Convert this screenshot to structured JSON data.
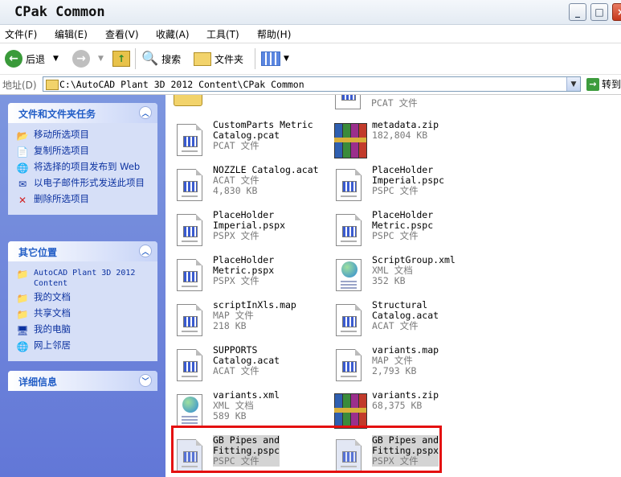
{
  "window": {
    "title": "CPak Common"
  },
  "menu": {
    "items": [
      "文件(F)",
      "编辑(E)",
      "查看(V)",
      "收藏(A)",
      "工具(T)",
      "帮助(H)"
    ]
  },
  "toolbar": {
    "back_label": "后退",
    "search_label": "搜索",
    "folders_label": "文件夹"
  },
  "address": {
    "label": "地址(D)",
    "path": "C:\\AutoCAD Plant 3D 2012 Content\\CPak Common",
    "go_label": "转到"
  },
  "left_pane": {
    "tasks": {
      "title": "文件和文件夹任务",
      "items": [
        "移动所选项目",
        "复制所选项目",
        "将选择的项目发布到 Web",
        "以电子邮件形式发送此项目",
        "删除所选项目"
      ]
    },
    "places": {
      "title": "其它位置",
      "items": [
        "AutoCAD Plant 3D 2012 Content",
        "我的文档",
        "共享文档",
        "我的电脑",
        "网上邻居"
      ]
    },
    "details": {
      "title": "详细信息"
    }
  },
  "files": [
    {
      "line1": "CustomParts Metric",
      "line2": "Catalog.pcat",
      "line3": "PCAT 文件",
      "icon": "doc-icon"
    },
    {
      "line1": "metadata.zip",
      "line2": "182,804 KB",
      "line3": "",
      "icon": "zip-icon"
    },
    {
      "line1": "NOZZLE Catalog.acat",
      "line2": "ACAT 文件",
      "line3": "4,830 KB",
      "icon": "doc-icon"
    },
    {
      "line1": "PlaceHolder",
      "line2": "Imperial.pspc",
      "line3": "PSPC 文件",
      "icon": "doc-icon"
    },
    {
      "line1": "PlaceHolder",
      "line2": "Imperial.pspx",
      "line3": "PSPX 文件",
      "icon": "doc-icon"
    },
    {
      "line1": "PlaceHolder",
      "line2": "Metric.pspc",
      "line3": "PSPC 文件",
      "icon": "doc-icon"
    },
    {
      "line1": "PlaceHolder",
      "line2": "Metric.pspx",
      "line3": "PSPX 文件",
      "icon": "doc-icon"
    },
    {
      "line1": "ScriptGroup.xml",
      "line2": "XML 文档",
      "line3": "352 KB",
      "icon": "xml-icon"
    },
    {
      "line1": "scriptInXls.map",
      "line2": "MAP 文件",
      "line3": "218 KB",
      "icon": "doc-icon"
    },
    {
      "line1": "Structural",
      "line2": "Catalog.acat",
      "line3": "ACAT 文件",
      "icon": "doc-icon"
    },
    {
      "line1": "SUPPORTS",
      "line2": "Catalog.acat",
      "line3": "ACAT 文件",
      "icon": "doc-icon"
    },
    {
      "line1": "variants.map",
      "line2": "MAP 文件",
      "line3": "2,793 KB",
      "icon": "doc-icon"
    },
    {
      "line1": "variants.xml",
      "line2": "XML 文档",
      "line3": "589 KB",
      "icon": "xml-icon"
    },
    {
      "line1": "variants.zip",
      "line2": "68,375 KB",
      "line3": "",
      "icon": "zip-icon"
    },
    {
      "line1": "GB Pipes and",
      "line2": "Fitting.pspc",
      "line3": "PSPC 文件",
      "icon": "doc-icon"
    },
    {
      "line1": "GB Pipes and",
      "line2": "Fitting.pspx",
      "line3": "PSPX 文件",
      "icon": "doc-icon"
    }
  ],
  "partial_top": {
    "right_line": "PCAT 文件"
  }
}
